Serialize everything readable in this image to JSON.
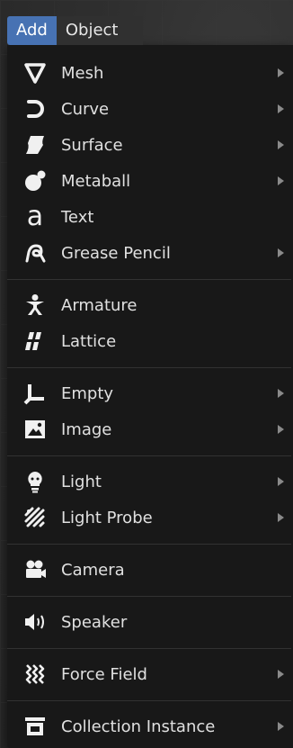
{
  "header": {
    "tabs": [
      {
        "label": "Add",
        "active": true
      },
      {
        "label": "Object",
        "active": false
      }
    ]
  },
  "menu": {
    "items": [
      {
        "label": "Mesh",
        "icon": "mesh-icon",
        "submenu": true
      },
      {
        "label": "Curve",
        "icon": "curve-icon",
        "submenu": true
      },
      {
        "label": "Surface",
        "icon": "surface-icon",
        "submenu": true
      },
      {
        "label": "Metaball",
        "icon": "metaball-icon",
        "submenu": true
      },
      {
        "label": "Text",
        "icon": "text-icon",
        "submenu": false
      },
      {
        "label": "Grease Pencil",
        "icon": "grease-pencil-icon",
        "submenu": true
      },
      {
        "label": "Armature",
        "icon": "armature-icon",
        "submenu": false
      },
      {
        "label": "Lattice",
        "icon": "lattice-icon",
        "submenu": false
      },
      {
        "label": "Empty",
        "icon": "empty-icon",
        "submenu": true
      },
      {
        "label": "Image",
        "icon": "image-icon",
        "submenu": true
      },
      {
        "label": "Light",
        "icon": "light-icon",
        "submenu": true
      },
      {
        "label": "Light Probe",
        "icon": "light-probe-icon",
        "submenu": true
      },
      {
        "label": "Camera",
        "icon": "camera-icon",
        "submenu": false
      },
      {
        "label": "Speaker",
        "icon": "speaker-icon",
        "submenu": false
      },
      {
        "label": "Force Field",
        "icon": "force-field-icon",
        "submenu": true
      },
      {
        "label": "Collection Instance",
        "icon": "collection-instance-icon",
        "submenu": true
      }
    ]
  },
  "colors": {
    "accent": "#4772b3",
    "menu_bg": "#181818",
    "text": "#e0e0e0"
  }
}
